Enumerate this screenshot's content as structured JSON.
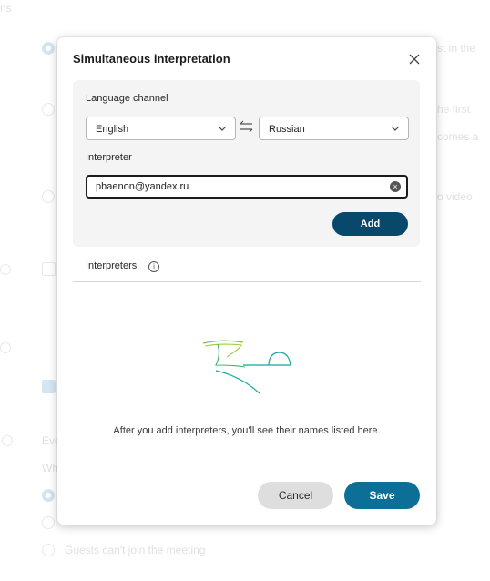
{
  "background": {
    "fragments": [
      "ns",
      "st in the",
      "he first",
      "comes a",
      "o video",
      "Eve",
      "Wh"
    ],
    "guests_option": "Guests can't join the meeting"
  },
  "dialog": {
    "title": "Simultaneous interpretation",
    "language_channel_label": "Language channel",
    "source_language": "English",
    "target_language": "Russian",
    "interpreter_label": "Interpreter",
    "interpreter_value": "phaenon@yandex.ru",
    "add_label": "Add",
    "interpreters_label": "Interpreters",
    "empty_message": "After you add interpreters, you'll see their names listed here.",
    "cancel_label": "Cancel",
    "save_label": "Save"
  },
  "colors": {
    "add_button": "#07486b",
    "save_button": "#0c6f98",
    "illustration_green": "#7cc242",
    "illustration_teal": "#12a89e"
  },
  "icons": [
    "close-icon",
    "chevron-down-icon",
    "swap-languages-icon",
    "clear-input-icon",
    "info-icon",
    "empty-state-illustration"
  ]
}
